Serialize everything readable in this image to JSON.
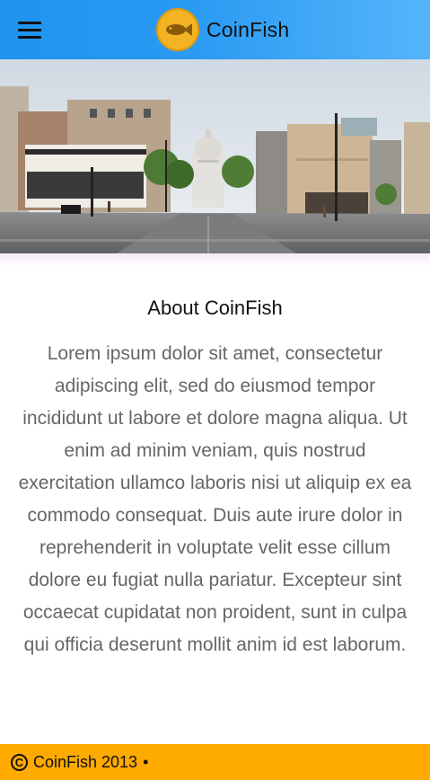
{
  "header": {
    "brand_name": "CoinFish",
    "menu_icon": "hamburger-menu-icon",
    "logo_icon": "fish-coin-logo-icon",
    "background_colors": [
      "#1e94ef",
      "#55b5fb"
    ]
  },
  "hero": {
    "image": "city-street-capitol-photo"
  },
  "about": {
    "title": "About CoinFish",
    "body": "Lorem ipsum dolor sit amet, consectetur adipiscing elit, sed do eiusmod tempor incididunt ut labore et dolore magna aliqua. Ut enim ad minim veniam, quis nostrud exercitation ullamco laboris nisi ut aliquip ex ea commodo consequat. Duis aute irure dolor in reprehenderit in voluptate velit esse cillum dolore eu fugiat nulla pariatur. Excepteur sint occaecat cupidatat non proident, sunt in culpa qui officia deserunt mollit anim id est laborum."
  },
  "footer": {
    "copyright_symbol": "C",
    "text": "CoinFish 2013",
    "separator": "•",
    "background_color": "#ffaa00"
  }
}
